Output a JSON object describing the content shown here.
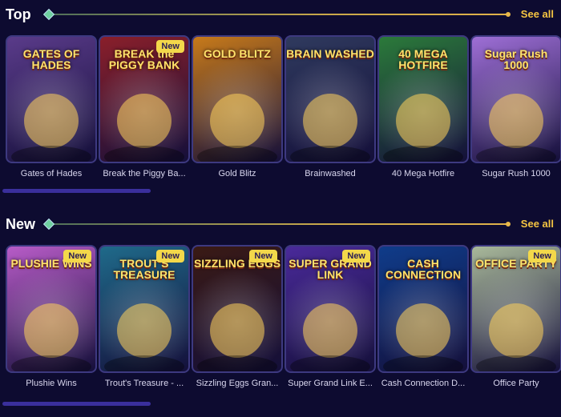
{
  "sections": {
    "top": {
      "title": "Top",
      "see_all": "See all",
      "games": [
        {
          "name": "Gates of Hades",
          "badge": "",
          "art": "GATES OF HADES",
          "bg": "#5a3b8a"
        },
        {
          "name": "Break the Piggy Ba...",
          "badge": "New",
          "art": "BREAK the PIGGY BANK",
          "bg": "#8a1f2a"
        },
        {
          "name": "Gold Blitz",
          "badge": "",
          "art": "GOLD BLITZ",
          "bg": "#c77a1a"
        },
        {
          "name": "Brainwashed",
          "badge": "",
          "art": "BRAIN WASHED",
          "bg": "#2f3a5e"
        },
        {
          "name": "40 Mega Hotfire",
          "badge": "",
          "art": "40 MEGA HOTFIRE",
          "bg": "#2b7a3a"
        },
        {
          "name": "Sugar Rush 1000",
          "badge": "",
          "art": "Sugar Rush 1000",
          "bg": "#9e6fd6"
        }
      ]
    },
    "new": {
      "title": "New",
      "see_all": "See all",
      "games": [
        {
          "name": "Plushie Wins",
          "badge": "New",
          "art": "PLUSHIE WINS",
          "bg": "#b85cc8"
        },
        {
          "name": "Trout's Treasure - ...",
          "badge": "New",
          "art": "TROUT'S TREASURE",
          "bg": "#1f6a8a"
        },
        {
          "name": "Sizzling Eggs Gran...",
          "badge": "New",
          "art": "SIZZLING EGGS",
          "bg": "#3a1a14"
        },
        {
          "name": "Super Grand Link E...",
          "badge": "New",
          "art": "SUPER GRAND LINK",
          "bg": "#4a2a9a"
        },
        {
          "name": "Cash Connection D...",
          "badge": "",
          "art": "CASH CONNECTION",
          "bg": "#0f3c8a"
        },
        {
          "name": "Office Party",
          "badge": "New",
          "art": "OFFICE PARTY",
          "bg": "#a9b99a"
        }
      ]
    }
  },
  "colors": {
    "background": "#0d0b30",
    "accent": "#f5c542",
    "badge": "#f3d84a",
    "card_border": "#3d3980",
    "scrollbar": "#3a2f9c"
  }
}
